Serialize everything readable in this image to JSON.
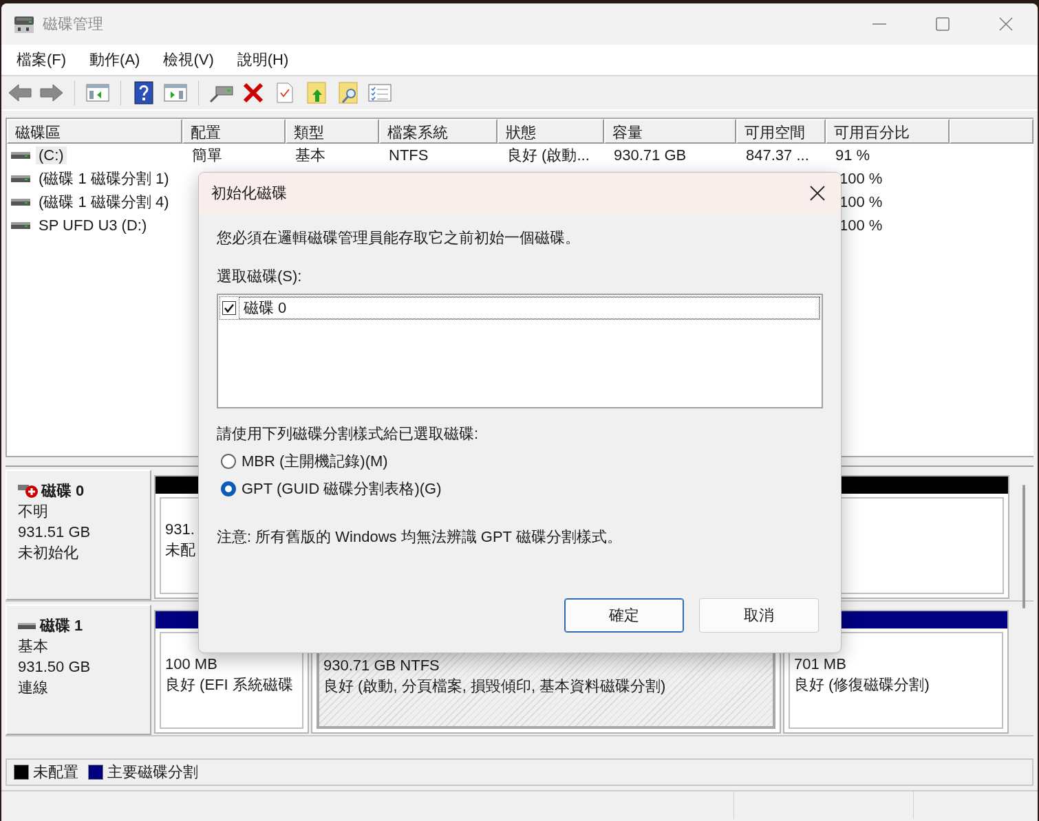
{
  "window": {
    "title": "磁碟管理"
  },
  "menu": [
    "檔案(F)",
    "動作(A)",
    "檢視(V)",
    "說明(H)"
  ],
  "volume_list": {
    "columns": [
      "磁碟區",
      "配置",
      "類型",
      "檔案系統",
      "狀態",
      "容量",
      "可用空間",
      "可用百分比"
    ],
    "rows": [
      {
        "name": "(C:)",
        "layout": "簡單",
        "type": "基本",
        "file_system": "NTFS",
        "status": "良好 (啟動...",
        "capacity": "930.71 GB",
        "free": "847.37 ...",
        "percent": "91 %",
        "selected": true
      },
      {
        "name": "(磁碟 1 磁碟分割 1)",
        "percent": "100 %",
        "selected": false
      },
      {
        "name": "(磁碟 1 磁碟分割 4)",
        "percent": "100 %",
        "selected": false
      },
      {
        "name": "SP UFD U3 (D:)",
        "percent": "100 %",
        "selected": false
      }
    ]
  },
  "disks": [
    {
      "name": "磁碟 0",
      "initialized": false,
      "info": [
        "不明",
        "931.51 GB",
        "未初始化"
      ],
      "partitions": [
        {
          "color": "#000000",
          "selected": false,
          "lines": [
            "931.",
            "未配"
          ]
        }
      ]
    },
    {
      "name": "磁碟 1",
      "initialized": true,
      "info": [
        "基本",
        "931.50 GB",
        "連線"
      ],
      "partitions": [
        {
          "color": "#000080",
          "selected": false,
          "lines": [
            "100 MB",
            "良好 (EFI 系統磁碟"
          ]
        },
        {
          "selected": true,
          "lines": [
            "930.71 GB NTFS",
            "良好 (啟動, 分頁檔案, 損毀傾印, 基本資料磁碟分割)"
          ]
        },
        {
          "color": "#000080",
          "selected": false,
          "lines": [
            "701 MB",
            "良好 (修復磁碟分割)"
          ]
        }
      ]
    }
  ],
  "legend": [
    {
      "label": "未配置",
      "color": "#000000"
    },
    {
      "label": "主要磁碟分割",
      "color": "#000080"
    }
  ],
  "dialog": {
    "title": "初始化磁碟",
    "message": "您必須在邏輯磁碟管理員能存取它之前初始一個磁碟。",
    "list_label": "選取磁碟(S):",
    "disks": [
      {
        "label": "磁碟 0",
        "checked": true,
        "selected": true
      }
    ],
    "style_label": "請使用下列磁碟分割樣式給已選取磁碟:",
    "styles": [
      {
        "label": "MBR (主開機記錄)(M)",
        "selected": false
      },
      {
        "label": "GPT (GUID 磁碟分割表格)(G)",
        "selected": true
      }
    ],
    "note": "注意: 所有舊版的 Windows 均無法辨識 GPT 磁碟分割樣式。",
    "buttons": [
      {
        "label": "確定",
        "default": true
      },
      {
        "label": "取消",
        "default": false
      }
    ]
  }
}
